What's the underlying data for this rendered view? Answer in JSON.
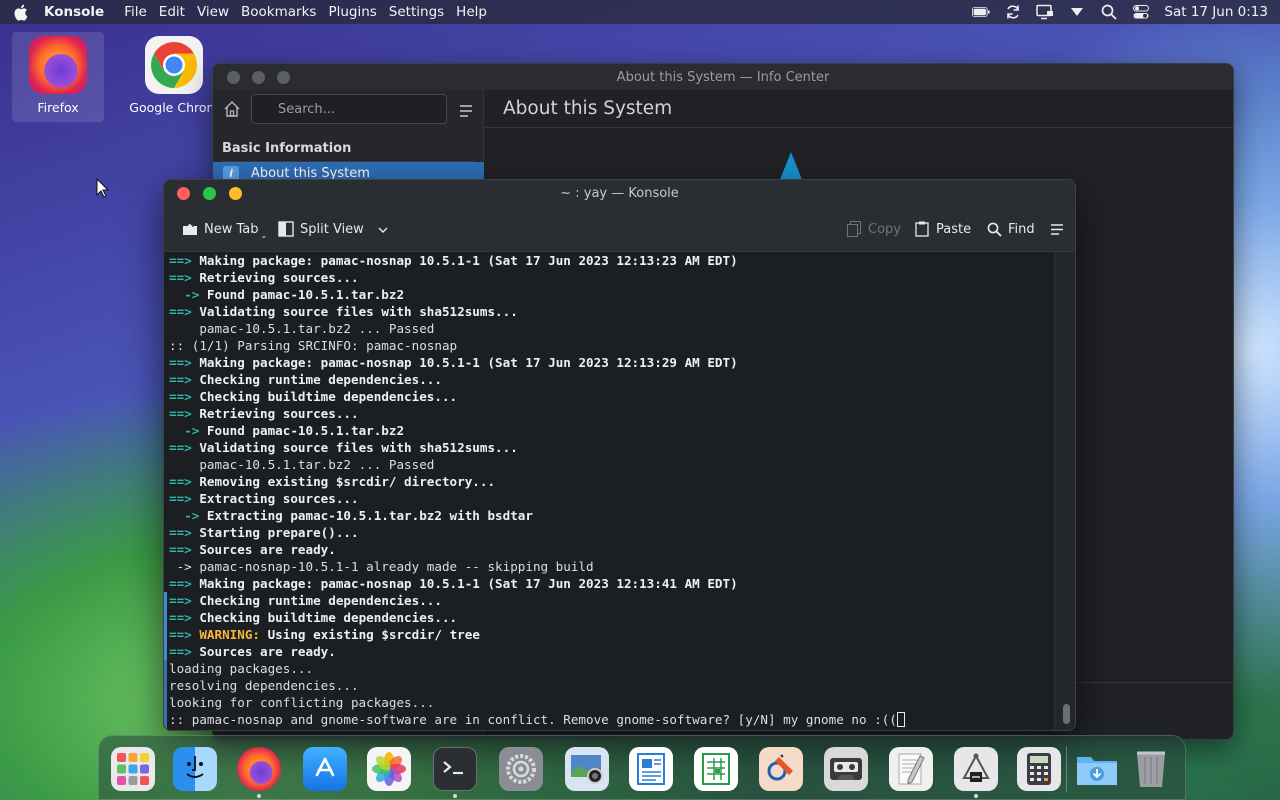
{
  "menubar": {
    "app_name": "Konsole",
    "menus": [
      "File",
      "Edit",
      "View",
      "Bookmarks",
      "Plugins",
      "Settings",
      "Help"
    ],
    "datetime": "Sat 17 Jun 0:13"
  },
  "desktop": {
    "icons": [
      {
        "label": "Firefox"
      },
      {
        "label": "Google Chrom"
      }
    ]
  },
  "info_center": {
    "window_title": "About this System — Info Center",
    "search_placeholder": "Search...",
    "section": "Basic Information",
    "selected_item": "About this System",
    "page_title": "About this System"
  },
  "konsole": {
    "window_title": "~ : yay — Konsole",
    "toolbar": {
      "new_tab": "New Tab",
      "split_view": "Split View",
      "copy": "Copy",
      "paste": "Paste",
      "find": "Find"
    },
    "lines": [
      {
        "prefix": "==> ",
        "style": "arrow",
        "text": "Making package: pamac-nosnap 10.5.1-1 (Sat 17 Jun 2023 12:13:23 AM EDT)",
        "bold": true
      },
      {
        "prefix": "==> ",
        "style": "arrow",
        "text": "Retrieving sources...",
        "bold": true
      },
      {
        "prefix": "  -> ",
        "style": "arrow",
        "text": "Found pamac-10.5.1.tar.bz2",
        "bold": true
      },
      {
        "prefix": "==> ",
        "style": "arrow",
        "text": "Validating source files with sha512sums...",
        "bold": true
      },
      {
        "prefix": "    ",
        "style": "none",
        "text": "pamac-10.5.1.tar.bz2 ... Passed",
        "bold": false
      },
      {
        "prefix": "",
        "style": "none",
        "text": ":: (1/1) Parsing SRCINFO: pamac-nosnap",
        "bold": false
      },
      {
        "prefix": "==> ",
        "style": "arrow",
        "text": "Making package: pamac-nosnap 10.5.1-1 (Sat 17 Jun 2023 12:13:29 AM EDT)",
        "bold": true
      },
      {
        "prefix": "==> ",
        "style": "arrow",
        "text": "Checking runtime dependencies...",
        "bold": true
      },
      {
        "prefix": "==> ",
        "style": "arrow",
        "text": "Checking buildtime dependencies...",
        "bold": true
      },
      {
        "prefix": "==> ",
        "style": "arrow",
        "text": "Retrieving sources...",
        "bold": true
      },
      {
        "prefix": "  -> ",
        "style": "arrow",
        "text": "Found pamac-10.5.1.tar.bz2",
        "bold": true
      },
      {
        "prefix": "==> ",
        "style": "arrow",
        "text": "Validating source files with sha512sums...",
        "bold": true
      },
      {
        "prefix": "    ",
        "style": "none",
        "text": "pamac-10.5.1.tar.bz2 ... Passed",
        "bold": false
      },
      {
        "prefix": "==> ",
        "style": "arrow",
        "text": "Removing existing $srcdir/ directory...",
        "bold": true
      },
      {
        "prefix": "==> ",
        "style": "arrow",
        "text": "Extracting sources...",
        "bold": true
      },
      {
        "prefix": "  -> ",
        "style": "arrow",
        "text": "Extracting pamac-10.5.1.tar.bz2 with bsdtar",
        "bold": true
      },
      {
        "prefix": "==> ",
        "style": "arrow",
        "text": "Starting prepare()...",
        "bold": true
      },
      {
        "prefix": "==> ",
        "style": "arrow",
        "text": "Sources are ready.",
        "bold": true
      },
      {
        "prefix": "",
        "style": "none",
        "text": " -> pamac-nosnap-10.5.1-1 already made -- skipping build",
        "bold": false
      },
      {
        "prefix": "==> ",
        "style": "arrow",
        "text": "Making package: pamac-nosnap 10.5.1-1 (Sat 17 Jun 2023 12:13:41 AM EDT)",
        "bold": true
      },
      {
        "prefix": "==> ",
        "style": "arrow",
        "text": "Checking runtime dependencies...",
        "bold": true
      },
      {
        "prefix": "==> ",
        "style": "arrow",
        "text": "Checking buildtime dependencies...",
        "bold": true
      },
      {
        "prefix": "==> ",
        "style": "warn",
        "label": "WARNING:",
        "text": " Using existing $srcdir/ tree",
        "bold": true
      },
      {
        "prefix": "==> ",
        "style": "arrow",
        "text": "Sources are ready.",
        "bold": true
      },
      {
        "prefix": "",
        "style": "none",
        "text": "loading packages...",
        "bold": false
      },
      {
        "prefix": "",
        "style": "none",
        "text": "resolving dependencies...",
        "bold": false
      },
      {
        "prefix": "",
        "style": "none",
        "text": "looking for conflicting packages...",
        "bold": false
      },
      {
        "prefix": "",
        "style": "none",
        "text": ":: pamac-nosnap and gnome-software are in conflict. Remove gnome-software? [y/N] my gnome no :((",
        "bold": false
      }
    ]
  },
  "dock": {
    "apps": [
      "launcher-icon",
      "finder-icon",
      "firefox-icon",
      "app-store-icon",
      "photos-icon",
      "terminal-icon",
      "settings-icon",
      "screenshot-icon",
      "writer-icon",
      "calc-icon",
      "draw-icon",
      "cassette-icon",
      "text-editor-icon",
      "kompare-icon",
      "calculator-icon",
      "downloads-folder-icon",
      "trash-icon"
    ]
  },
  "colors": {
    "arrow": "#2fb3a8",
    "warning": "#f6b73c",
    "selection": "#2f6fb8"
  }
}
